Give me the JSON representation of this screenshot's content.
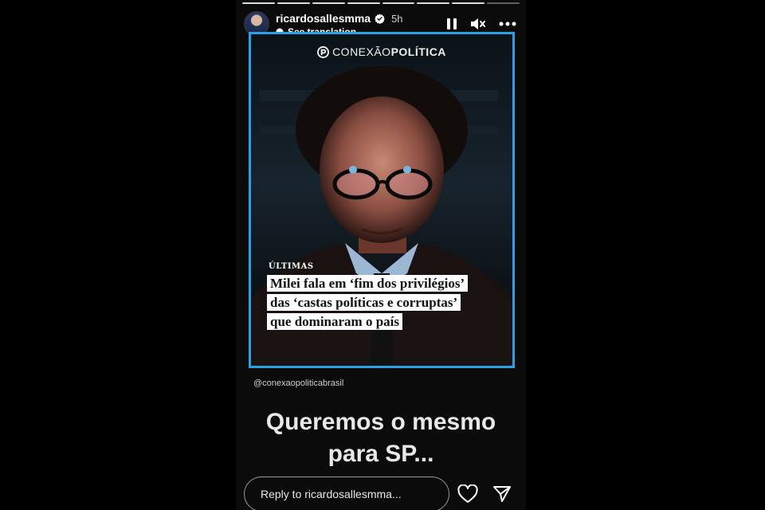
{
  "story": {
    "progress_segments": [
      {
        "done": true
      },
      {
        "done": true
      },
      {
        "done": true
      },
      {
        "done": true
      },
      {
        "done": true
      },
      {
        "done": true
      },
      {
        "done": true
      },
      {
        "done": false
      }
    ],
    "username": "ricardosallesmma",
    "time_ago": "5h",
    "see_translation": "See translation",
    "icons": {
      "pause": "pause-icon",
      "mute": "speaker-muted-icon",
      "more": "more-options-icon"
    }
  },
  "post": {
    "brand_light": "CONEXÃO",
    "brand_bold": "POLÍTICA",
    "tag": "ÚLTIMAS",
    "headline_lines": [
      "Milei fala em ‘fim dos privilégios’",
      "das ‘castas políticas e corruptas’",
      "que dominaram o país"
    ],
    "border_color": "#2aa1e6"
  },
  "handle": "@conexaopoliticabrasil",
  "caption_lines": [
    "Queremos o mesmo",
    "para SP..."
  ],
  "footer": {
    "reply_placeholder": "Reply to ricardosallesmma..."
  }
}
